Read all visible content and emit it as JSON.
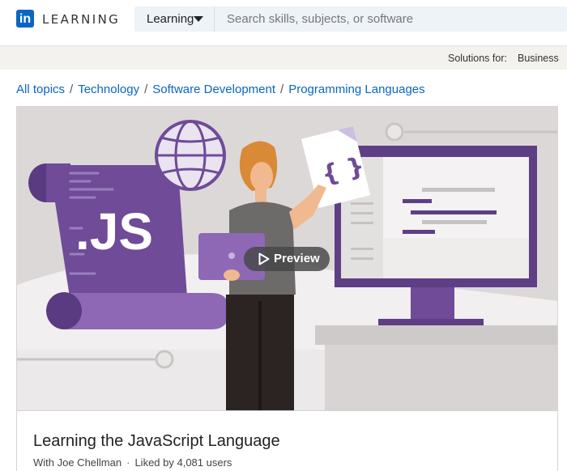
{
  "header": {
    "logo_mark": "in",
    "logo_text": "LEARNING",
    "search_category": "Learning",
    "search_placeholder": "Search skills, subjects, or software"
  },
  "subheader": {
    "solutions_label": "Solutions for:",
    "business_label": "Business"
  },
  "breadcrumb": [
    "All topics",
    "Technology",
    "Software Development",
    "Programming Languages"
  ],
  "breadcrumb_separator": "/",
  "hero": {
    "preview_label": "Preview",
    "illustration_text": ".JS",
    "document_text": "{ }"
  },
  "course": {
    "title": "Learning the JavaScript Language",
    "author": "With Joe Chellman",
    "separator": "·",
    "likes": "Liked by 4,081 users"
  },
  "colors": {
    "brand_blue": "#0a66c2",
    "purple": "#6f4b98",
    "purple_light": "#8e68b5"
  }
}
